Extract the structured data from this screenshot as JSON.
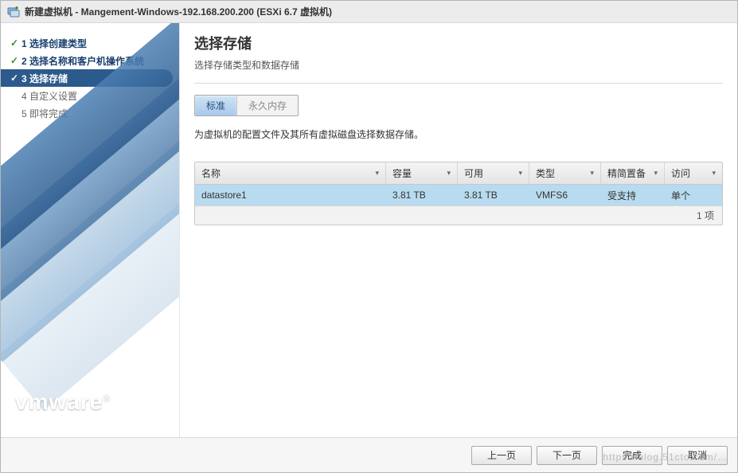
{
  "title_bar": {
    "icon": "new-vm",
    "text": "新建虚拟机 - Mangement-Windows-192.168.200.200 (ESXi 6.7 虚拟机)"
  },
  "sidebar": {
    "steps": [
      {
        "label": "1 选择创建类型",
        "status": "completed"
      },
      {
        "label": "2 选择名称和客户机操作系统",
        "status": "completed"
      },
      {
        "label": "3 选择存储",
        "status": "active"
      },
      {
        "label": "4 自定义设置",
        "status": "incomplete"
      },
      {
        "label": "5 即将完成",
        "status": "incomplete"
      }
    ],
    "brand": "vmware"
  },
  "main": {
    "title": "选择存储",
    "subtitle": "选择存储类型和数据存储",
    "seg": {
      "standard": "标准",
      "pmem": "永久内存"
    },
    "instructions": "为虚拟机的配置文件及其所有虚拟磁盘选择数据存储。",
    "columns": {
      "name": "名称",
      "capacity": "容量",
      "free": "可用",
      "type": "类型",
      "provision": "精简置备",
      "access": "访问"
    },
    "rows": [
      {
        "name": "datastore1",
        "capacity": "3.81 TB",
        "free": "3.81 TB",
        "type": "VMFS6",
        "provision": "受支持",
        "access": "单个"
      }
    ],
    "footer_count": "1 项"
  },
  "buttons": {
    "back": "上一页",
    "next": "下一页",
    "finish": "完成",
    "cancel": "取消"
  },
  "watermark": "https://blog.51cto.com/…"
}
